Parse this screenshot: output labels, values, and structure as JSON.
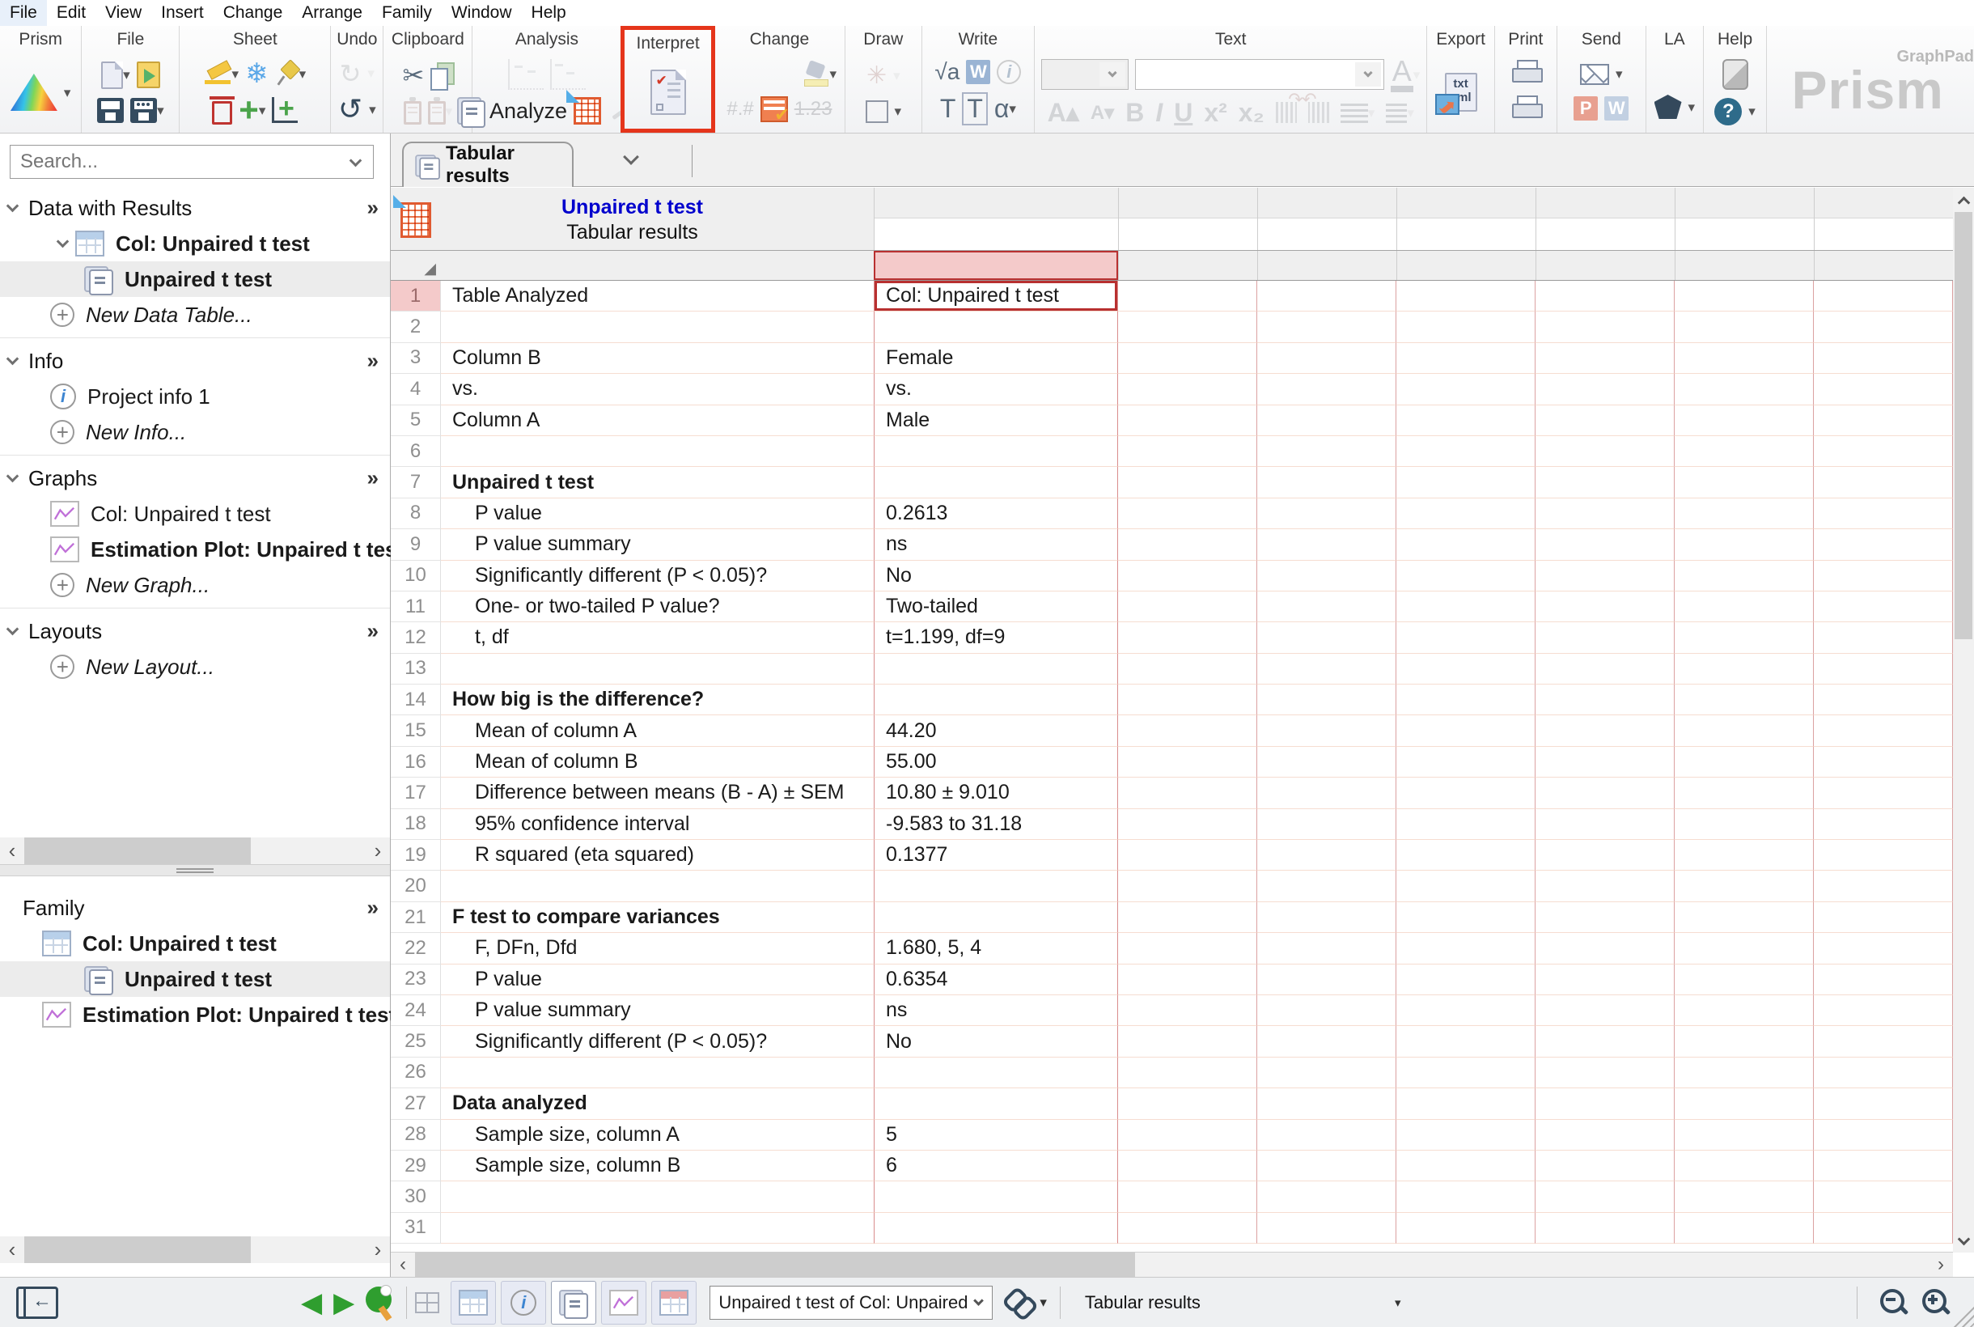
{
  "menu_bar": {
    "items": [
      "File",
      "Edit",
      "View",
      "Insert",
      "Change",
      "Arrange",
      "Family",
      "Window",
      "Help"
    ]
  },
  "toolbar": {
    "groups": [
      "Prism",
      "File",
      "Sheet",
      "Undo",
      "Clipboard",
      "Analysis",
      "Interpret",
      "Change",
      "Draw",
      "Write",
      "Text",
      "Export",
      "Print",
      "Send",
      "LA",
      "Help"
    ],
    "analyze_label": "Analyze",
    "brand": {
      "graphpad": "GraphPad",
      "prism": "Prism"
    },
    "highlight_color": "#e5351b"
  },
  "icons": {
    "caret": "▾",
    "chevrons_right": "»",
    "plus": "+",
    "plus_circle": "+",
    "scissors": "✂",
    "snowflake": "❄",
    "undo": "↻",
    "redo": "↻",
    "left_tri": "◀",
    "right_tri": "▶",
    "left_arrow": "‹",
    "right_arrow": "›",
    "sqrt_a": "√a",
    "alpha": "α",
    "letter_T": "T",
    "letter_W": "W",
    "letter_P": "P",
    "bold": "B",
    "italic": "I",
    "underline": "U",
    "sup": "x²",
    "sub": "x₂",
    "grow_a": "A▴",
    "shrink_a": "A▾",
    "color_a": "A",
    "hash": "#.#",
    "num123": "1.23",
    "star": "✳",
    "txt": "txt",
    "xml": "xml",
    "question": "?",
    "info_i": "i",
    "square": "",
    "w_doc": "W",
    "p_doc": "P"
  },
  "sidebar": {
    "search_placeholder": "Search...",
    "sections": [
      {
        "label": "Data with Results",
        "items": [
          {
            "label": "Col: Unpaired t test"
          },
          {
            "label": "Unpaired t test"
          },
          {
            "label": "New Data Table..."
          }
        ]
      },
      {
        "label": "Info",
        "items": [
          {
            "label": "Project info 1"
          },
          {
            "label": "New Info..."
          }
        ]
      },
      {
        "label": "Graphs",
        "items": [
          {
            "label": "Col: Unpaired t test"
          },
          {
            "label": "Estimation Plot: Unpaired t test of"
          },
          {
            "label": "New Graph..."
          }
        ]
      },
      {
        "label": "Layouts",
        "items": [
          {
            "label": "New Layout..."
          }
        ]
      }
    ],
    "family": {
      "label": "Family",
      "items": [
        {
          "label": "Col: Unpaired t test"
        },
        {
          "label": "Unpaired t test"
        },
        {
          "label": "Estimation Plot: Unpaired t test of"
        }
      ]
    }
  },
  "main": {
    "tab_label": "Tabular results",
    "sheet_title": "Unpaired t test",
    "sheet_subtitle": "Tabular results",
    "results_table": {
      "column_header": "Col: Unpaired t test",
      "rows": [
        {
          "num": 1,
          "label": "Table Analyzed",
          "value": "Col: Unpaired t test",
          "selected": true
        },
        {
          "num": 2,
          "label": "",
          "value": ""
        },
        {
          "num": 3,
          "label": "Column B",
          "value": "Female"
        },
        {
          "num": 4,
          "label": "vs.",
          "value": "vs."
        },
        {
          "num": 5,
          "label": "Column A",
          "value": "Male"
        },
        {
          "num": 6,
          "label": "",
          "value": ""
        },
        {
          "num": 7,
          "label": "Unpaired t test",
          "value": "",
          "bold": true
        },
        {
          "num": 8,
          "label": "P value",
          "value": "0.2613",
          "indent": true
        },
        {
          "num": 9,
          "label": "P value summary",
          "value": "ns",
          "indent": true
        },
        {
          "num": 10,
          "label": "Significantly different (P < 0.05)?",
          "value": "No",
          "indent": true
        },
        {
          "num": 11,
          "label": "One- or two-tailed P value?",
          "value": "Two-tailed",
          "indent": true
        },
        {
          "num": 12,
          "label": "t, df",
          "value": "t=1.199, df=9",
          "indent": true
        },
        {
          "num": 13,
          "label": "",
          "value": ""
        },
        {
          "num": 14,
          "label": "How big is the difference?",
          "value": "",
          "bold": true
        },
        {
          "num": 15,
          "label": "Mean of column A",
          "value": "44.20",
          "indent": true
        },
        {
          "num": 16,
          "label": "Mean of column B",
          "value": "55.00",
          "indent": true
        },
        {
          "num": 17,
          "label": "Difference between means (B - A) ± SEM",
          "value": "10.80 ± 9.010",
          "indent": true
        },
        {
          "num": 18,
          "label": "95% confidence interval",
          "value": "-9.583 to 31.18",
          "indent": true
        },
        {
          "num": 19,
          "label": "R squared (eta squared)",
          "value": "0.1377",
          "indent": true
        },
        {
          "num": 20,
          "label": "",
          "value": ""
        },
        {
          "num": 21,
          "label": "F test to compare variances",
          "value": "",
          "bold": true
        },
        {
          "num": 22,
          "label": "F, DFn, Dfd",
          "value": "1.680, 5, 4",
          "indent": true
        },
        {
          "num": 23,
          "label": "P value",
          "value": "0.6354",
          "indent": true
        },
        {
          "num": 24,
          "label": "P value summary",
          "value": "ns",
          "indent": true
        },
        {
          "num": 25,
          "label": "Significantly different (P < 0.05)?",
          "value": "No",
          "indent": true
        },
        {
          "num": 26,
          "label": "",
          "value": ""
        },
        {
          "num": 27,
          "label": "Data analyzed",
          "value": "",
          "bold": true
        },
        {
          "num": 28,
          "label": "Sample size, column A",
          "value": "5",
          "indent": true
        },
        {
          "num": 29,
          "label": "Sample size, column B",
          "value": "6",
          "indent": true
        },
        {
          "num": 30,
          "label": "",
          "value": ""
        },
        {
          "num": 31,
          "label": "",
          "value": ""
        }
      ]
    }
  },
  "status_bar": {
    "sheet_selector": "Unpaired t test of Col: Unpaired",
    "sheet_name": "Tabular results"
  },
  "colors": {
    "interpret_highlight": "#e5351b",
    "selected_cell_border": "#b83030",
    "selected_header_fill": "#f4caca",
    "sheet_title_blue": "#0000cd",
    "grid_vertical": "#d98c8c",
    "grid_horizontal": "#f6ddd1"
  }
}
